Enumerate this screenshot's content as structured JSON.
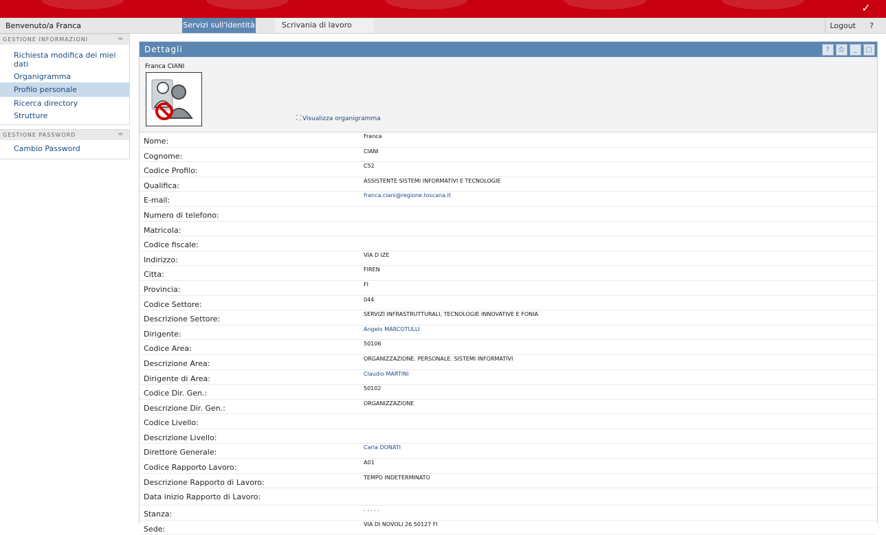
{
  "header": {
    "welcome": "Benvenuto/a Franca",
    "logout": "Logout",
    "help": "?"
  },
  "tabs": [
    {
      "label": "Servizi sull'Identità",
      "active": true
    },
    {
      "label": "Scrivania di lavoro",
      "active": false
    }
  ],
  "sidebar": {
    "sections": [
      {
        "title": "GESTIONE INFORMAZIONI",
        "items": [
          {
            "label": "Richiesta modifica dei miei dati",
            "selected": false
          },
          {
            "label": "Organigramma",
            "selected": false
          },
          {
            "label": "Profilo personale",
            "selected": true
          },
          {
            "label": "Ricerca directory",
            "selected": false
          },
          {
            "label": "Strutture",
            "selected": false
          }
        ]
      },
      {
        "title": "GESTIONE PASSWORD",
        "items": [
          {
            "label": "Cambio Password",
            "selected": false
          }
        ]
      }
    ]
  },
  "panel": {
    "title": "Dettagli",
    "buttons": [
      "help-icon",
      "print-icon",
      "minimize-icon",
      "maximize-icon"
    ],
    "person_name": "Franca CIANI",
    "org_chart_link": "Visualizza organigramma"
  },
  "details": [
    {
      "label": "Nome:",
      "value": "Franca",
      "link": false
    },
    {
      "label": "Cognome:",
      "value": "CIANI",
      "link": false
    },
    {
      "label": "Codice Profilo:",
      "value": "C52",
      "link": false
    },
    {
      "label": "Qualifica:",
      "value": "ASSISTENTE SISTEMI INFORMATIVI E TECNOLOGIE",
      "link": false
    },
    {
      "label": "E-mail:",
      "value": "franca.ciani@regione.toscana.it",
      "link": true
    },
    {
      "label": "Numero di telefono:",
      "value": "",
      "link": false
    },
    {
      "label": "Matricola:",
      "value": "",
      "link": false
    },
    {
      "label": "Codice fiscale:",
      "value": "",
      "link": false
    },
    {
      "label": "Indirizzo:",
      "value": "VIA D                                   IZE",
      "link": false
    },
    {
      "label": "Citta:",
      "value": "FIREN",
      "link": false
    },
    {
      "label": "Provincia:",
      "value": "FI",
      "link": false
    },
    {
      "label": "Codice Settore:",
      "value": "044",
      "link": false
    },
    {
      "label": "Descrizione Settore:",
      "value": "SERVIZI INFRASTRUTTURALI, TECNOLOGIE INNOVATIVE E FONIA",
      "link": false
    },
    {
      "label": "Dirigente:",
      "value": "Angelo MARCOTULLI",
      "link": true
    },
    {
      "label": "Codice Area:",
      "value": "50106",
      "link": false
    },
    {
      "label": "Descrizione Area:",
      "value": "ORGANIZZAZIONE. PERSONALE. SISTEMI INFORMATIVI",
      "link": false
    },
    {
      "label": "Dirigente di Area:",
      "value": "Claudio MARTINI",
      "link": true
    },
    {
      "label": "Codice Dir. Gen.:",
      "value": "50102",
      "link": false
    },
    {
      "label": "Descrizione Dir. Gen.:",
      "value": "ORGANIZZAZIONE",
      "link": false
    },
    {
      "label": "Codice Livello:",
      "value": "",
      "link": false
    },
    {
      "label": "Descrizione Livello:",
      "value": "",
      "link": false
    },
    {
      "label": "Direttore Generale:",
      "value": "Carla DONATI",
      "link": true
    },
    {
      "label": "Codice Rapporto Lavoro:",
      "value": "A01",
      "link": false
    },
    {
      "label": "Descrizione Rapporto di Lavoro:",
      "value": "TEMPO INDETERMINATO",
      "link": false
    },
    {
      "label": "Data inizio Rapporto di Lavoro:",
      "value": "",
      "link": false
    },
    {
      "label": "Stanza:",
      "value": ". . . . .",
      "link": false
    },
    {
      "label": "Sede:",
      "value": "VIA DI NOVOLI 26 50127 FI",
      "link": false
    }
  ],
  "colors": {
    "banner": "#c8000f",
    "accent": "#5c86b2",
    "link": "#1b4a83",
    "selected": "#c9daea"
  }
}
